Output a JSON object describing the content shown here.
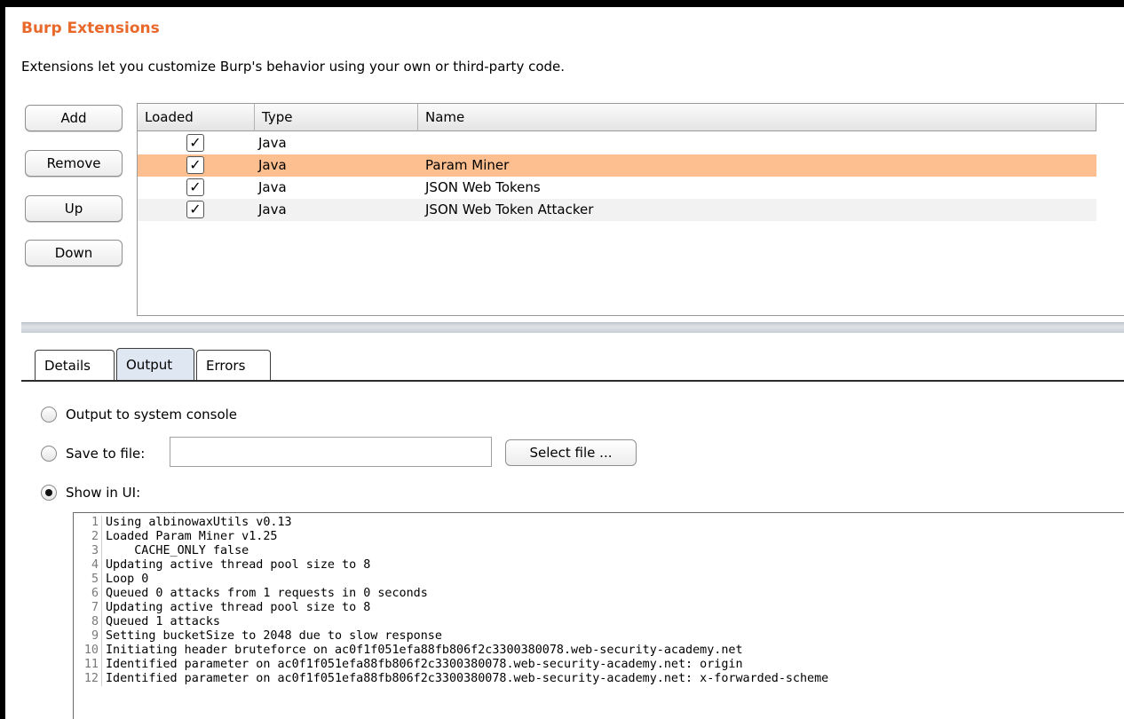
{
  "header": {
    "title": "Burp Extensions",
    "description": "Extensions let you customize Burp's behavior using your own or third-party code."
  },
  "buttons": {
    "add": "Add",
    "remove": "Remove",
    "up": "Up",
    "down": "Down"
  },
  "table": {
    "columns": [
      "Loaded",
      "Type",
      "Name"
    ],
    "rows": [
      {
        "loaded": "✓",
        "type": "Java",
        "name": ""
      },
      {
        "loaded": "✓",
        "type": "Java",
        "name": "Param Miner"
      },
      {
        "loaded": "✓",
        "type": "Java",
        "name": "JSON Web Tokens"
      },
      {
        "loaded": "✓",
        "type": "Java",
        "name": "JSON Web Token Attacker"
      }
    ]
  },
  "tabs": [
    "Details",
    "Output",
    "Errors"
  ],
  "output": {
    "option_console": "Output to system console",
    "option_file": "Save to file:",
    "select_file": "Select file ...",
    "option_ui": "Show in UI:",
    "file_value": ""
  },
  "console": {
    "lines": [
      {
        "n": "1",
        "t": "Using albinowaxUtils v0.13"
      },
      {
        "n": "2",
        "t": "Loaded Param Miner v1.25"
      },
      {
        "n": "3",
        "t": "    CACHE_ONLY false"
      },
      {
        "n": "4",
        "t": "Updating active thread pool size to 8"
      },
      {
        "n": "5",
        "t": "Loop 0"
      },
      {
        "n": "6",
        "t": "Queued 0 attacks from 1 requests in 0 seconds"
      },
      {
        "n": "7",
        "t": "Updating active thread pool size to 8"
      },
      {
        "n": "8",
        "t": "Queued 1 attacks"
      },
      {
        "n": "9",
        "t": "Setting bucketSize to 2048 due to slow response"
      },
      {
        "n": "10",
        "t": "Initiating header bruteforce on ac0f1f051efa88fb806f2c3300380078.web-security-academy.net"
      },
      {
        "n": "11",
        "t": "Identified parameter on ac0f1f051efa88fb806f2c3300380078.web-security-academy.net: origin"
      },
      {
        "n": "12",
        "t": "Identified parameter on ac0f1f051efa88fb806f2c3300380078.web-security-academy.net: x-forwarded-scheme"
      }
    ]
  }
}
